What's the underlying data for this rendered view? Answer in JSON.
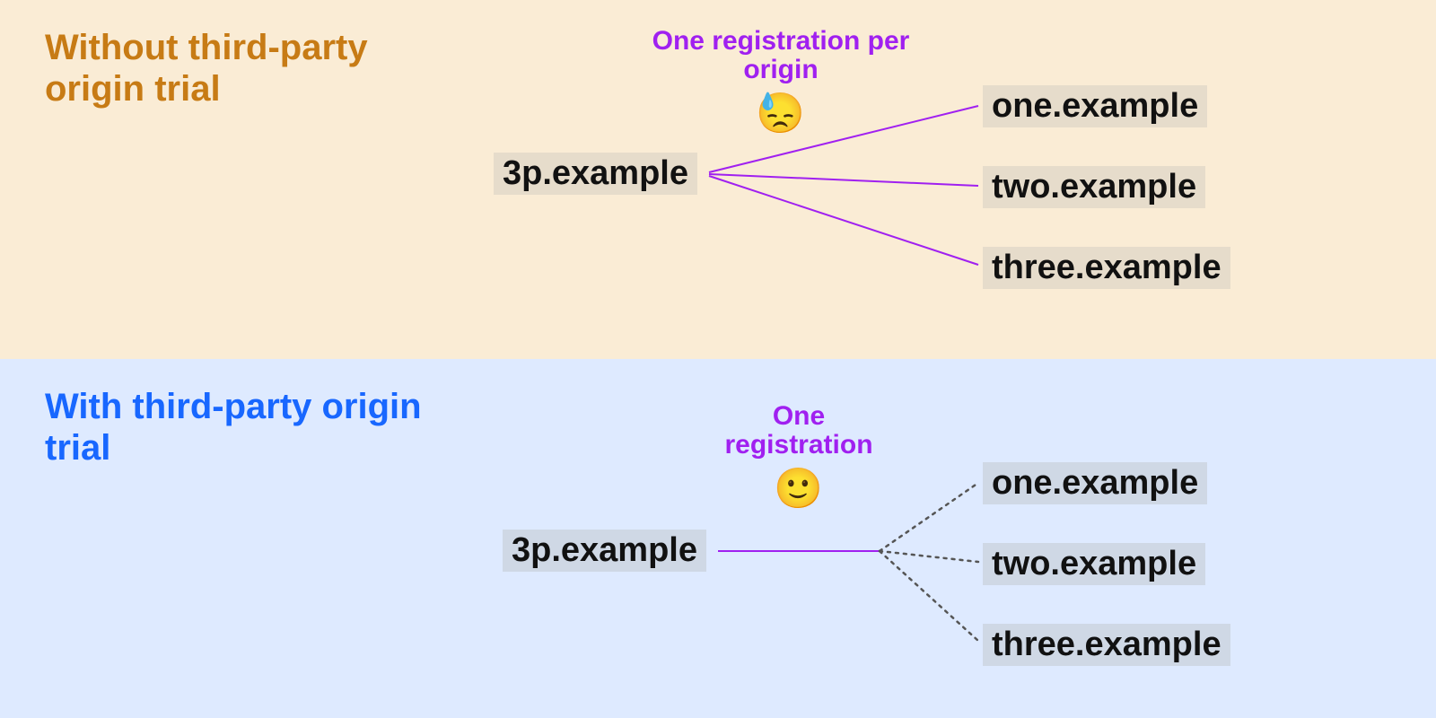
{
  "top": {
    "title": "Without third-party origin trial",
    "caption": "One registration per origin",
    "emoji": "😓",
    "source": "3p.example",
    "targets": [
      "one.example",
      "two.example",
      "three.example"
    ],
    "colors": {
      "title": "#c77b15",
      "bg": "#faecd5",
      "labelBg": "#e6dccb",
      "line": "#a020f0"
    }
  },
  "bottom": {
    "title": "With third-party origin trial",
    "caption": "One registration",
    "emoji": "🙂",
    "source": "3p.example",
    "targets": [
      "one.example",
      "two.example",
      "three.example"
    ],
    "colors": {
      "title": "#1867ff",
      "bg": "#deeaff",
      "labelBg": "#cfd8e5",
      "line": "#a020f0",
      "dotted": "#555"
    }
  }
}
